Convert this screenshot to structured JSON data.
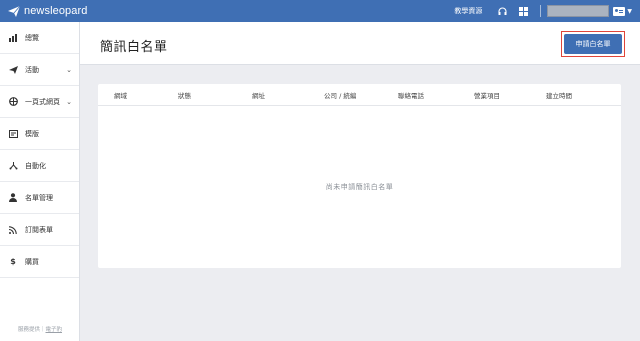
{
  "app": {
    "logo_text": "newsleopard"
  },
  "topbar": {
    "tutorial_link": "教學資源",
    "icons": [
      "paper-plane-icon",
      "headset-icon",
      "grid-icon",
      "user-card-icon",
      "caret-down-icon"
    ]
  },
  "sidebar": {
    "items": [
      {
        "label": "總覽",
        "icon": "bar-chart-icon",
        "has_chevron": false
      },
      {
        "label": "活動",
        "icon": "paper-plane-icon",
        "has_chevron": true
      },
      {
        "label": "一頁式網頁",
        "icon": "layout-icon",
        "has_chevron": true
      },
      {
        "label": "模版",
        "icon": "template-icon",
        "has_chevron": false
      },
      {
        "label": "自動化",
        "icon": "automation-icon",
        "has_chevron": false
      },
      {
        "label": "名單管理",
        "icon": "user-icon",
        "has_chevron": false
      },
      {
        "label": "訂閱表單",
        "icon": "rss-icon",
        "has_chevron": false
      },
      {
        "label": "購買",
        "icon": "dollar-icon",
        "has_chevron": false
      }
    ],
    "footer_prefix": "服務提供｜",
    "footer_link": "電子豹"
  },
  "main": {
    "title": "簡訊白名單",
    "apply_button": "申請白名單",
    "table": {
      "columns": [
        "網域",
        "狀態",
        "網址",
        "公司 / 統編",
        "聯絡電話",
        "營業項目",
        "建立時間"
      ],
      "rows": [],
      "empty_text": "尚未申請簡訊白名單"
    }
  },
  "colors": {
    "brand": "#3f6fb4",
    "highlight": "#e0453a"
  }
}
